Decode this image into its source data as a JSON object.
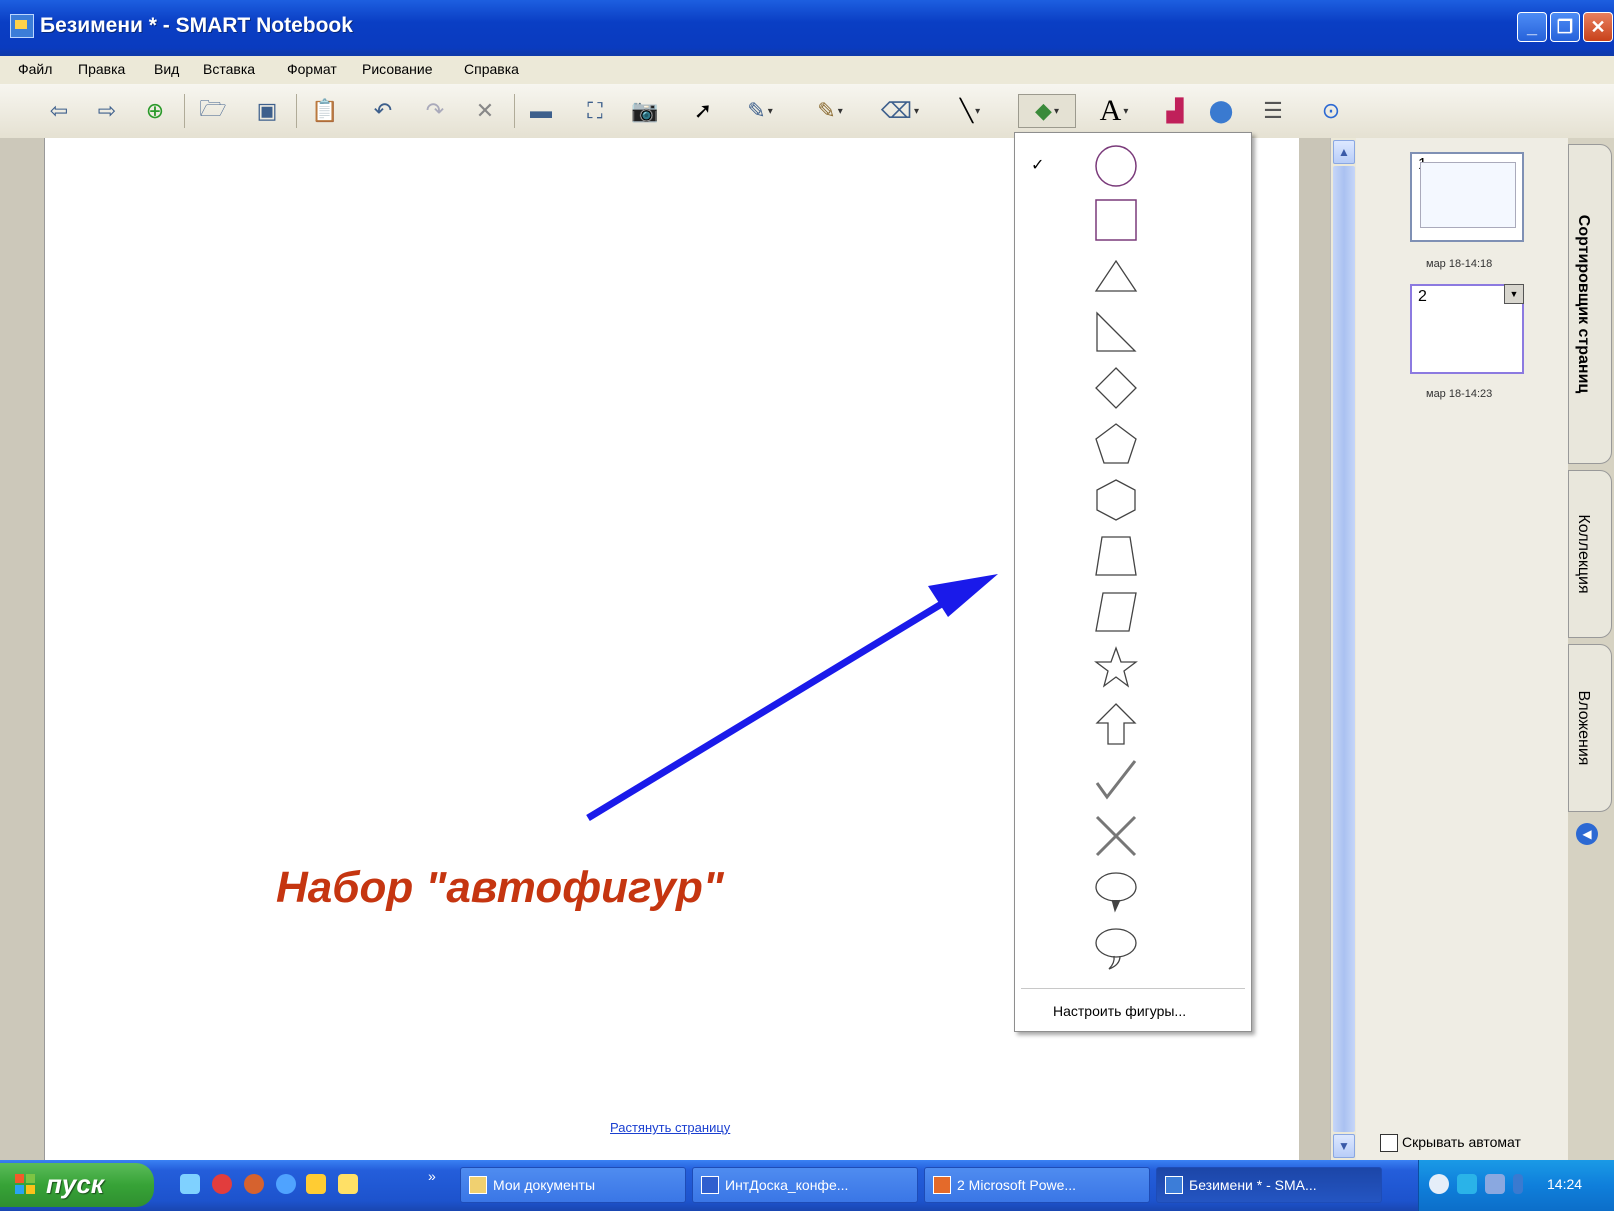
{
  "window": {
    "title": "Безимени * - SMART Notebook"
  },
  "menu": [
    "Файл",
    "Правка",
    "Вид",
    "Вставка",
    "Формат",
    "Рисование",
    "Справка"
  ],
  "toolbar": {
    "buttons": [
      "back-icon",
      "forward-icon",
      "add-page-icon",
      "open-icon",
      "save-icon",
      "paste-icon",
      "undo-icon",
      "redo-icon",
      "delete-icon",
      "screen-shade-icon",
      "full-screen-icon",
      "capture-icon",
      "select-icon",
      "pen-icon",
      "creative-pen-icon",
      "eraser-icon",
      "line-icon",
      "shapes-icon",
      "text-icon",
      "fill-icon",
      "properties-icon",
      "more-icon",
      "help-icon"
    ]
  },
  "shapes_dropdown": {
    "items": [
      "circle",
      "square",
      "triangle",
      "right-triangle",
      "diamond",
      "pentagon",
      "hexagon",
      "trapezoid",
      "parallelogram",
      "star",
      "arrow-up",
      "checkmark",
      "cross",
      "speech-bubble",
      "thought-bubble"
    ],
    "selected": "circle",
    "check_glyph": "✓",
    "customize_label": "Настроить фигуры..."
  },
  "canvas": {
    "stretch_link": "Растянуть страницу",
    "annotation": "Набор \"автофигур\"",
    "annotation_color": "#c53510",
    "arrow_color": "#1a1aea"
  },
  "sidebar": {
    "pages": [
      {
        "number": "1",
        "time": "мар 18-14:18"
      },
      {
        "number": "2",
        "time": "мар 18-14:23"
      }
    ],
    "tabs": [
      "Сортировщик страниц",
      "Коллекция",
      "Вложения"
    ],
    "autohide_label": "Скрывать автомат"
  },
  "taskbar": {
    "start_label": "пуск",
    "tasks": [
      {
        "label": "Мои документы"
      },
      {
        "label": "ИнтДоска_конфе..."
      },
      {
        "label": "2 Microsoft Powe..."
      },
      {
        "label": "Безимени * - SMA..."
      }
    ],
    "expand_glyph": "»",
    "clock": "14:24"
  },
  "colors": {
    "accent": "#245edb",
    "shape_stroke": "#7a3a7a"
  }
}
